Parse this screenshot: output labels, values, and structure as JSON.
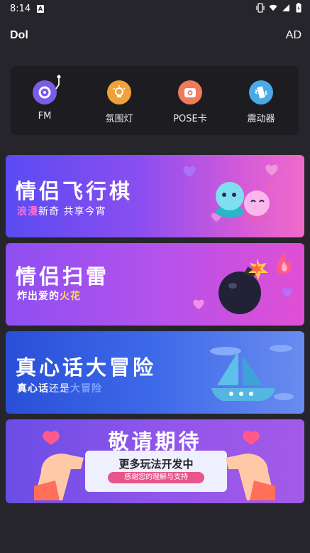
{
  "status": {
    "time": "8:14",
    "notif_glyph": "A"
  },
  "app": {
    "title": "Dol",
    "ad_label": "AD"
  },
  "tools": [
    {
      "label": "FM",
      "icon": "vinyl-record-icon",
      "color": "#7a5ce6"
    },
    {
      "label": "氛围灯",
      "icon": "lightbulb-icon",
      "color": "#f0a23a"
    },
    {
      "label": "POSE卡",
      "icon": "camera-icon",
      "color": "#f07a5a"
    },
    {
      "label": "震动器",
      "icon": "vibrate-phone-icon",
      "color": "#4aa9e8"
    }
  ],
  "cards": [
    {
      "title": "情侣飞行棋",
      "sub_highlight": "浪漫",
      "sub_rest": "新奇 共享今宵",
      "highlight_color": "#ff6fd3"
    },
    {
      "title": "情侣扫雷",
      "sub_plain": "炸出爱的",
      "sub_highlight": "火花",
      "highlight_color": "#ffd86a"
    },
    {
      "title": "真心话大冒险",
      "sub_a": "真心话",
      "sub_b": "还是",
      "sub_c": "大冒险",
      "highlight_color": "#6b8dff"
    },
    {
      "title": "敬请期待",
      "note_main": "更多玩法开发中",
      "note_sub": "感谢您的理解与支持"
    }
  ]
}
